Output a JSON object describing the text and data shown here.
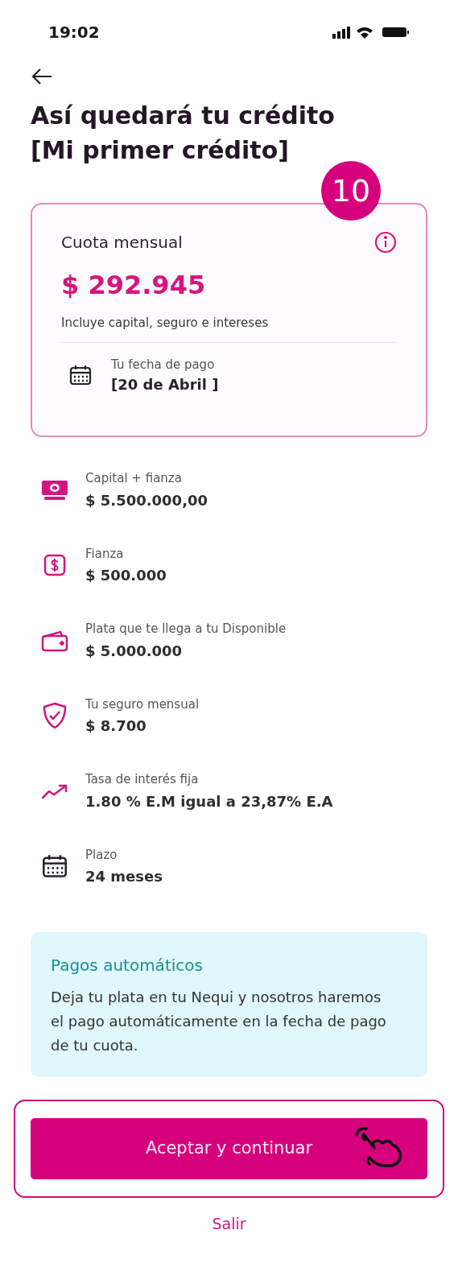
{
  "status_bar": {
    "time": "19:02"
  },
  "title": "Así quedará tu crédito [Mi primer crédito]",
  "step_badge": "10",
  "summary_card": {
    "label": "Cuota mensual",
    "amount": "$ 292.945",
    "note": "Incluye capital, seguro e intereses",
    "date_label": "Tu fecha de pago",
    "date_value": "[20 de Abril ]"
  },
  "details": [
    {
      "label": "Capital + fianza",
      "value": "$ 5.500.000,00"
    },
    {
      "label": "Fianza",
      "value": "$ 500.000"
    },
    {
      "label": "Plata que te llega a tu Disponible",
      "value": "$ 5.000.000"
    },
    {
      "label": "Tu seguro mensual",
      "value": "$ 8.700"
    },
    {
      "label": "Tasa de interés fija",
      "value": "1.80 % E.M igual a 23,87% E.A"
    },
    {
      "label": "Plazo",
      "value": "24 meses"
    }
  ],
  "info_box": {
    "title": "Pagos automáticos",
    "text": "Deja tu plata en tu Nequi y nosotros haremos el pago automáticamente en la fecha de pago de tu cuota."
  },
  "buttons": {
    "primary": "Aceptar y continuar",
    "secondary": "Salir"
  }
}
